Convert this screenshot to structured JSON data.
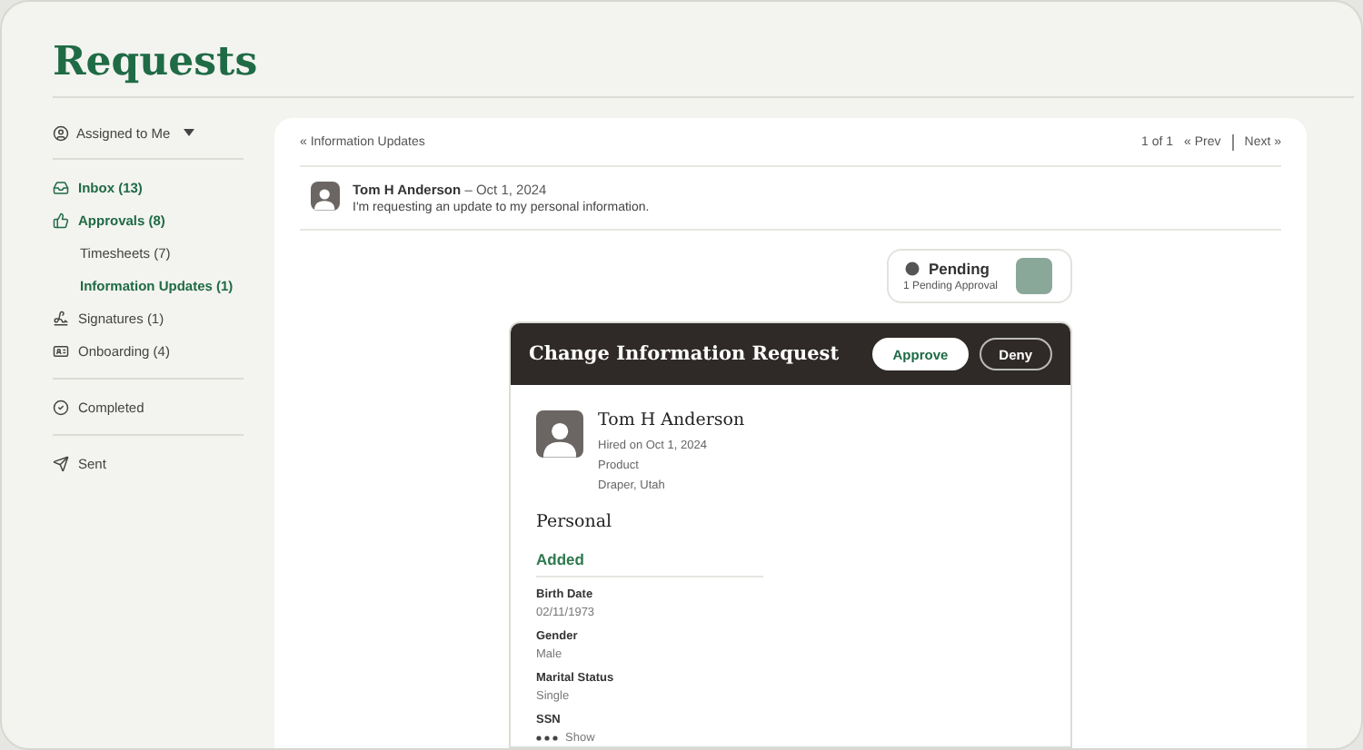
{
  "page_title": "Requests",
  "filter": {
    "label": "Assigned to Me"
  },
  "sidebar": {
    "groups": [
      [
        {
          "kind": "inbox",
          "label": "Inbox (13)",
          "active": true
        },
        {
          "kind": "approvals",
          "label": "Approvals (8)",
          "active": true,
          "children": [
            {
              "label": "Timesheets (7)",
              "active": false
            },
            {
              "label": "Information Updates (1)",
              "active": true
            }
          ]
        },
        {
          "kind": "signatures",
          "label": "Signatures (1)",
          "active": false
        },
        {
          "kind": "onboarding",
          "label": "Onboarding (4)",
          "active": false
        }
      ],
      [
        {
          "kind": "completed",
          "label": "Completed",
          "active": false
        }
      ],
      [
        {
          "kind": "sent",
          "label": "Sent",
          "active": false
        }
      ]
    ]
  },
  "detail": {
    "back_link": "« Information Updates",
    "pager": {
      "count": "1 of 1",
      "prev": "« Prev",
      "next": "Next »"
    },
    "message": {
      "author": "Tom H Anderson",
      "date": "– Oct 1, 2024",
      "text": "I'm requesting an update to my personal information."
    },
    "status": {
      "title": "Pending",
      "subtitle": "1 Pending Approval"
    },
    "request": {
      "title": "Change Information Request",
      "buttons": [
        {
          "label": "Approve",
          "kind": "primary"
        },
        {
          "label": "Deny",
          "kind": "outline"
        }
      ],
      "employee": {
        "name": "Tom H Anderson",
        "lines": [
          "Hired on Oct 1, 2024",
          "Product",
          "Draper, Utah"
        ]
      },
      "section": "Personal",
      "subsection": "Added",
      "fields": [
        {
          "label": "Birth Date",
          "value": "02/11/1973"
        },
        {
          "label": "Gender",
          "value": "Male"
        },
        {
          "label": "Marital Status",
          "value": "Single"
        },
        {
          "label": "SSN",
          "value": "Show",
          "masked": true
        }
      ]
    }
  }
}
